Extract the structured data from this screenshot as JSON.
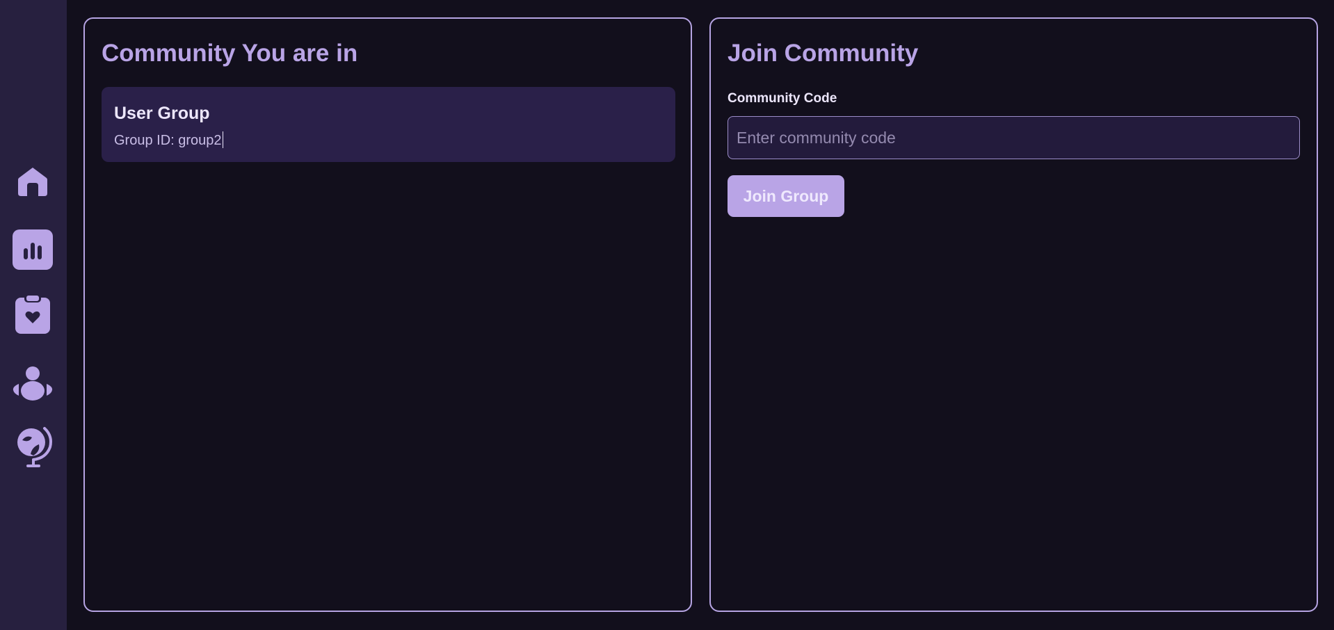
{
  "theme": {
    "accent": "#b9a4e6",
    "background": "#120f1c",
    "sidebar_bg": "#27203f",
    "card_bg": "#2a2049"
  },
  "sidebar": {
    "items": [
      {
        "icon": "home-icon"
      },
      {
        "icon": "bar-chart-icon"
      },
      {
        "icon": "clipboard-heart-icon"
      },
      {
        "icon": "community-icon"
      },
      {
        "icon": "globe-icon"
      }
    ]
  },
  "my_communities": {
    "title": "Community You are in",
    "groups": [
      {
        "name": "User Group",
        "id_text": "Group ID: group2"
      }
    ]
  },
  "join": {
    "title": "Join Community",
    "code_label": "Community Code",
    "code_value": "",
    "code_placeholder": "Enter community code",
    "button_label": "Join Group"
  }
}
